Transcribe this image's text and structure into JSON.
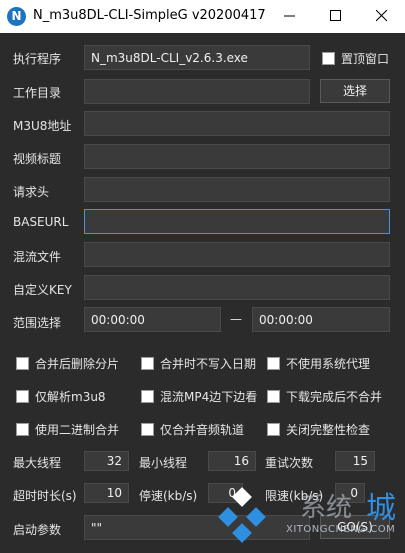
{
  "window": {
    "title": "N_m3u8DL-CLI-SimpleG v20200417",
    "logo_letter": "N"
  },
  "form": {
    "exec_label": "执行程序",
    "exec_value": "N_m3u8DL-CLI_v2.6.3.exe",
    "ontop_label": "置顶窗口",
    "workdir_label": "工作目录",
    "workdir_value": "",
    "select_button": "选择",
    "m3u8_label": "M3U8地址",
    "m3u8_value": "",
    "video_title_label": "视频标题",
    "video_title_value": "",
    "headers_label": "请求头",
    "headers_value": "",
    "baseurl_label": "BASEURL",
    "baseurl_value": "",
    "mux_label": "混流文件",
    "mux_value": "",
    "key_label": "自定义KEY",
    "key_value": "",
    "range_label": "范围选择",
    "range_start": "00:00:00",
    "range_sep": "—",
    "range_end": "00:00:00"
  },
  "options": [
    {
      "label": "合并后删除分片",
      "checked": false
    },
    {
      "label": "合并时不写入日期",
      "checked": false
    },
    {
      "label": "不使用系统代理",
      "checked": false
    },
    {
      "label": "仅解析m3u8",
      "checked": false
    },
    {
      "label": "混流MP4边下边看",
      "checked": false
    },
    {
      "label": "下载完成后不合并",
      "checked": false
    },
    {
      "label": "使用二进制合并",
      "checked": false
    },
    {
      "label": "仅合并音频轨道",
      "checked": false
    },
    {
      "label": "关闭完整性检查",
      "checked": false
    }
  ],
  "params": {
    "max_threads_label": "最大线程",
    "max_threads": "32",
    "min_threads_label": "最小线程",
    "min_threads": "16",
    "retry_label": "重试次数",
    "retry": "15",
    "timeout_label": "超时时长(s)",
    "timeout": "10",
    "stop_speed_label": "停速(kb/s)",
    "stop_speed": "0",
    "limit_speed_label": "限速(kb/s)",
    "limit_speed": "0"
  },
  "bottom": {
    "args_label": "启动参数",
    "args_value": "\"\"",
    "go_button": "GO(S)"
  },
  "watermark": {
    "text": "XITONGCHENG.COM",
    "cn": "系统",
    "cn2": "城"
  },
  "colors": {
    "background": "#2b2b2b",
    "field": "#3a3a3a",
    "focus_border": "#4d90d6",
    "logo_blue": "#1e73be"
  }
}
